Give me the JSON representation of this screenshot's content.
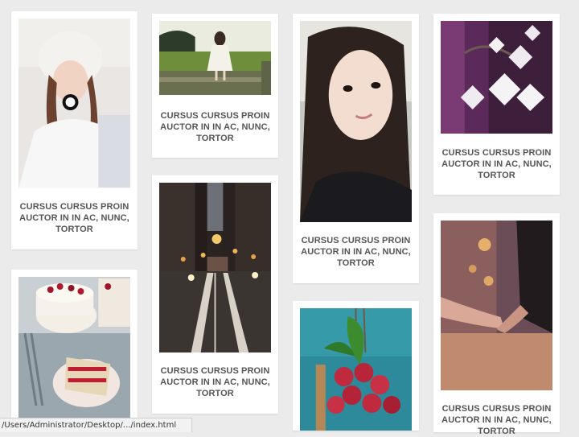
{
  "gallery": {
    "cards": [
      {
        "name": "card-girl-white-hat",
        "image": "girl-in-white-hat-photo",
        "caption": "CURSUS CURSUS PROIN AUCTOR IN IN AC, NUNC, TORTOR"
      },
      {
        "name": "card-girl-in-field",
        "image": "girl-in-field-photo",
        "caption": "CURSUS CURSUS PROIN AUCTOR IN IN AC, NUNC, TORTOR"
      },
      {
        "name": "card-girl-portrait",
        "image": "girl-portrait-photo",
        "caption": "CURSUS CURSUS PROIN AUCTOR IN IN AC, NUNC, TORTOR"
      },
      {
        "name": "card-white-flowers",
        "image": "white-flowers-photo",
        "caption": "CURSUS CURSUS PROIN AUCTOR IN IN AC, NUNC, TORTOR"
      },
      {
        "name": "card-city-street",
        "image": "city-street-night-photo",
        "caption": "CURSUS CURSUS PROIN AUCTOR IN IN AC, NUNC, TORTOR"
      },
      {
        "name": "card-holding-hands",
        "image": "holding-hands-photo",
        "caption": "CURSUS CURSUS PROIN AUCTOR IN IN AC, NUNC, TORTOR"
      },
      {
        "name": "card-cake",
        "image": "cake-slice-photo",
        "caption": ""
      },
      {
        "name": "card-lychees",
        "image": "lychees-photo",
        "caption": ""
      }
    ]
  },
  "status_bar": {
    "url": "/Users/Administrator/Desktop/.../index.html"
  }
}
